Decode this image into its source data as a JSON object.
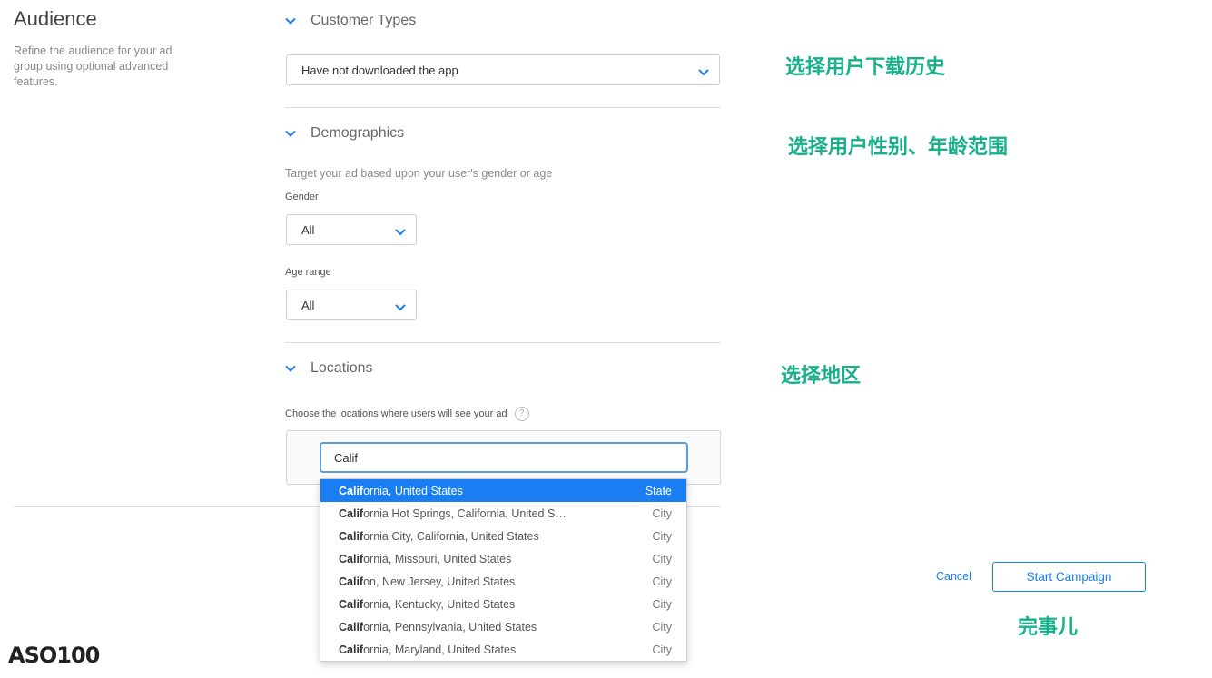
{
  "audience": {
    "title": "Audience",
    "description": "Refine the audience for your ad group using optional advanced features."
  },
  "customer_types": {
    "title": "Customer Types",
    "selected": "Have not downloaded the app"
  },
  "demographics": {
    "title": "Demographics",
    "hint": "Target your ad based upon your user's gender or age",
    "gender_label": "Gender",
    "gender_value": "All",
    "age_label": "Age range",
    "age_value": "All"
  },
  "locations": {
    "title": "Locations",
    "hint": "Choose the locations where users will see your ad",
    "help_glyph": "?",
    "search_value": "Calif",
    "results": [
      {
        "match": "Calif",
        "rest": "ornia, United States",
        "type": "State",
        "selected": true
      },
      {
        "match": "Calif",
        "rest": "ornia Hot Springs, California, United S…",
        "type": "City",
        "selected": false
      },
      {
        "match": "Calif",
        "rest": "ornia City, California, United States",
        "type": "City",
        "selected": false
      },
      {
        "match": "Calif",
        "rest": "ornia, Missouri, United States",
        "type": "City",
        "selected": false
      },
      {
        "match": "Calif",
        "rest": "on, New Jersey, United States",
        "type": "City",
        "selected": false
      },
      {
        "match": "Calif",
        "rest": "ornia, Kentucky, United States",
        "type": "City",
        "selected": false
      },
      {
        "match": "Calif",
        "rest": "ornia, Pennsylvania, United States",
        "type": "City",
        "selected": false
      },
      {
        "match": "Calif",
        "rest": "ornia, Maryland, United States",
        "type": "City",
        "selected": false
      }
    ]
  },
  "actions": {
    "cancel": "Cancel",
    "start": "Start Campaign"
  },
  "annotations": {
    "download_history": "选择用户下载历史",
    "gender_age": "选择用户性别、年龄范围",
    "region": "选择地区",
    "done": "完事儿"
  },
  "logo": {
    "text": "ASO100"
  },
  "colors": {
    "accent": "#1a7ef2",
    "annotation": "#17b08a"
  },
  "icons": {
    "section_toggle": "chevron-down-icon",
    "select_arrow": "chevron-down-icon",
    "help": "question-circle-icon"
  }
}
